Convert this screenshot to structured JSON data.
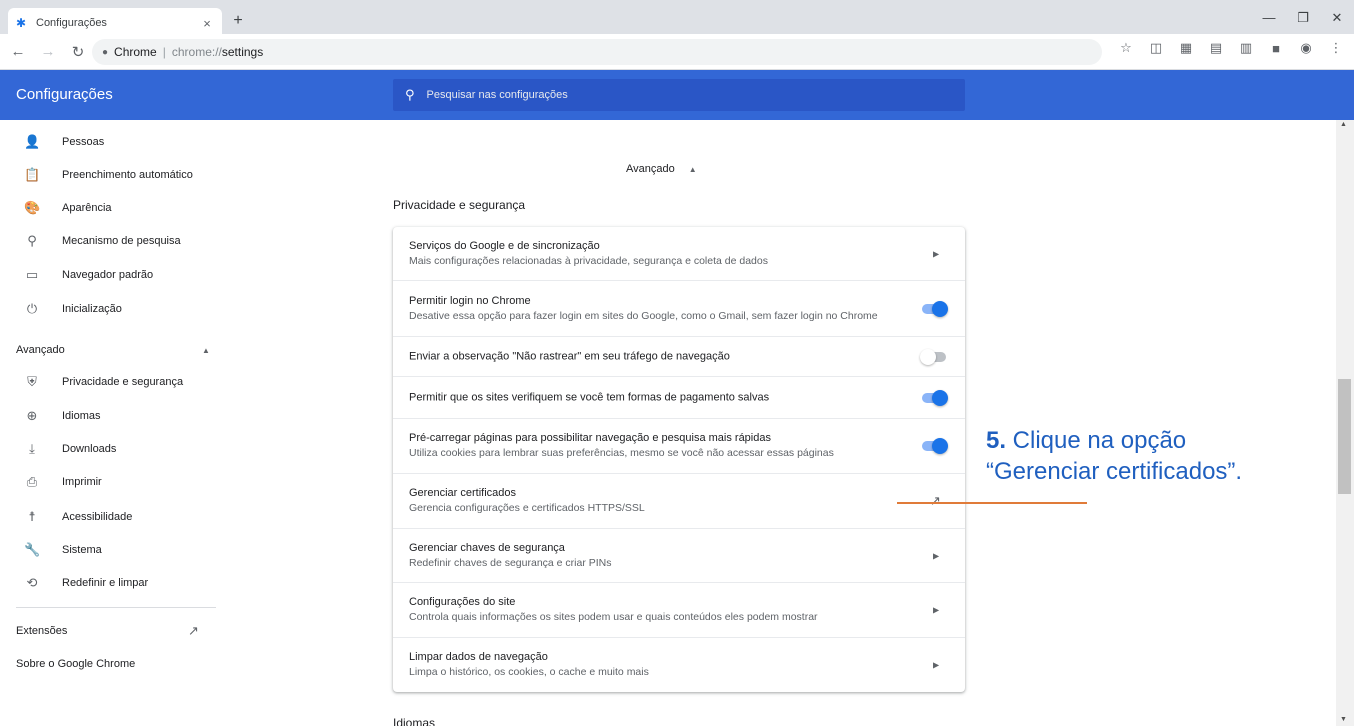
{
  "browser": {
    "tab_title": "Configurações",
    "tab_close": "×",
    "new_tab": "+",
    "url_site": "Chrome",
    "url_scheme": "chrome://",
    "url_path": "settings"
  },
  "header": {
    "title": "Configurações",
    "search_placeholder": "Pesquisar nas configurações"
  },
  "sidebar": {
    "items": [
      {
        "label": "Pessoas",
        "icon": "person-icon"
      },
      {
        "label": "Preenchimento automático",
        "icon": "clipboard-icon"
      },
      {
        "label": "Aparência",
        "icon": "palette-icon"
      },
      {
        "label": "Mecanismo de pesquisa",
        "icon": "search-icon"
      },
      {
        "label": "Navegador padrão",
        "icon": "browser-icon"
      },
      {
        "label": "Inicialização",
        "icon": "power-icon"
      }
    ],
    "advanced_label": "Avançado",
    "advanced_items": [
      {
        "label": "Privacidade e segurança",
        "icon": "shield-icon"
      },
      {
        "label": "Idiomas",
        "icon": "globe-icon"
      },
      {
        "label": "Downloads",
        "icon": "download-icon"
      },
      {
        "label": "Imprimir",
        "icon": "printer-icon"
      },
      {
        "label": "Acessibilidade",
        "icon": "accessibility-icon"
      },
      {
        "label": "Sistema",
        "icon": "wrench-icon"
      },
      {
        "label": "Redefinir e limpar",
        "icon": "reset-icon"
      }
    ],
    "extensions_label": "Extensões",
    "about_label": "Sobre o Google Chrome"
  },
  "main": {
    "advanced_heading": "Avançado",
    "section_title": "Privacidade e segurança",
    "rows": [
      {
        "primary": "Serviços do Google e de sincronização",
        "secondary": "Mais configurações relacionadas à privacidade, segurança e coleta de dados",
        "control": "arrow"
      },
      {
        "primary": "Permitir login no Chrome",
        "secondary": "Desative essa opção para fazer login em sites do Google, como o Gmail, sem fazer login no Chrome",
        "control": "toggle-on"
      },
      {
        "primary": "Enviar a observação \"Não rastrear\" em seu tráfego de navegação",
        "secondary": "",
        "control": "toggle-off"
      },
      {
        "primary": "Permitir que os sites verifiquem se você tem formas de pagamento salvas",
        "secondary": "",
        "control": "toggle-on"
      },
      {
        "primary": "Pré-carregar páginas para possibilitar navegação e pesquisa mais rápidas",
        "secondary": "Utiliza cookies para lembrar suas preferências, mesmo se você não acessar essas páginas",
        "control": "toggle-on"
      },
      {
        "primary": "Gerenciar certificados",
        "secondary": "Gerencia configurações e certificados HTTPS/SSL",
        "control": "external"
      },
      {
        "primary": "Gerenciar chaves de segurança",
        "secondary": "Redefinir chaves de segurança e criar PINs",
        "control": "arrow"
      },
      {
        "primary": "Configurações do site",
        "secondary": "Controla quais informações os sites podem usar e quais conteúdos eles podem mostrar",
        "control": "arrow"
      },
      {
        "primary": "Limpar dados de navegação",
        "secondary": "Limpa o histórico, os cookies, o cache e muito mais",
        "control": "arrow"
      }
    ],
    "next_section": "Idiomas"
  },
  "annotation": {
    "step": "5.",
    "line1": " Clique na opção",
    "line2": "“Gerenciar certificados”."
  },
  "colors": {
    "header_blue": "#3367d6",
    "toggle_on": "#1a73e8",
    "annotation_text": "#1f5fbf",
    "annotation_line": "#e07b39"
  }
}
